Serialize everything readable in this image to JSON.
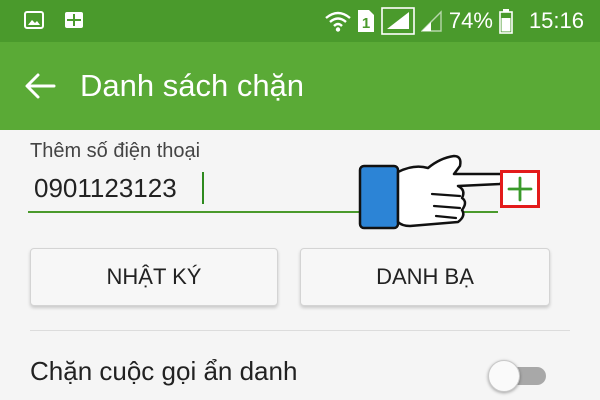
{
  "status_bar": {
    "battery_percent": "74%",
    "sim_slot": "1",
    "time": "15:16",
    "icons": [
      "image-icon",
      "grid-app-icon",
      "wifi-icon",
      "sim-icon",
      "signal-icon",
      "signal-weak-icon",
      "battery-icon"
    ]
  },
  "toolbar": {
    "title": "Danh sách chặn",
    "back_icon": "arrow-left-icon"
  },
  "add_number": {
    "label": "Thêm số điện thoại",
    "value": "0901123123",
    "add_icon": "plus-icon"
  },
  "buttons": {
    "log": "NHẬT KÝ",
    "contacts": "DANH BẠ"
  },
  "settings": {
    "block_unknown_label": "Chặn cuộc gọi ẩn danh",
    "block_unknown_enabled": false
  },
  "colors": {
    "status_bar": "#4a9a2c",
    "toolbar": "#5aaa36",
    "accent": "#4a9a2c",
    "highlight_border": "#e31b1b",
    "hand_cuff": "#2c84d6"
  }
}
